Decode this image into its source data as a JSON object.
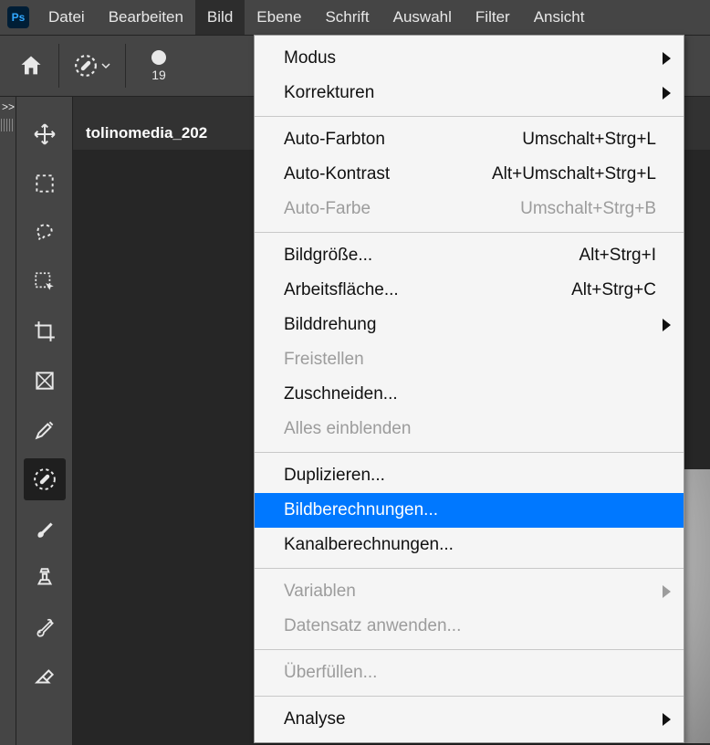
{
  "app": {
    "logo_text": "Ps"
  },
  "menubar": {
    "items": [
      "Datei",
      "Bearbeiten",
      "Bild",
      "Ebene",
      "Schrift",
      "Auswahl",
      "Filter",
      "Ansicht"
    ],
    "active_index": 2
  },
  "optionsbar": {
    "brush_size": "19"
  },
  "ruler": {
    "expand": ">>"
  },
  "tabs": {
    "active": "tolinomedia_202"
  },
  "dropdown": {
    "groups": [
      [
        {
          "label": "Modus",
          "submenu": true
        },
        {
          "label": "Korrekturen",
          "submenu": true
        }
      ],
      [
        {
          "label": "Auto-Farbton",
          "shortcut": "Umschalt+Strg+L"
        },
        {
          "label": "Auto-Kontrast",
          "shortcut": "Alt+Umschalt+Strg+L"
        },
        {
          "label": "Auto-Farbe",
          "shortcut": "Umschalt+Strg+B",
          "disabled": true
        }
      ],
      [
        {
          "label": "Bildgröße...",
          "shortcut": "Alt+Strg+I"
        },
        {
          "label": "Arbeitsfläche...",
          "shortcut": "Alt+Strg+C"
        },
        {
          "label": "Bilddrehung",
          "submenu": true
        },
        {
          "label": "Freistellen",
          "disabled": true
        },
        {
          "label": "Zuschneiden..."
        },
        {
          "label": "Alles einblenden",
          "disabled": true
        }
      ],
      [
        {
          "label": "Duplizieren..."
        },
        {
          "label": "Bildberechnungen...",
          "hover": true
        },
        {
          "label": "Kanalberechnungen..."
        }
      ],
      [
        {
          "label": "Variablen",
          "submenu": true,
          "disabled": true
        },
        {
          "label": "Datensatz anwenden...",
          "disabled": true
        }
      ],
      [
        {
          "label": "Überfüllen...",
          "disabled": true
        }
      ],
      [
        {
          "label": "Analyse",
          "submenu": true
        }
      ]
    ]
  },
  "tools": [
    {
      "name": "move-tool"
    },
    {
      "name": "marquee-tool"
    },
    {
      "name": "lasso-tool"
    },
    {
      "name": "object-select-tool"
    },
    {
      "name": "crop-tool"
    },
    {
      "name": "frame-tool"
    },
    {
      "name": "eyedropper-tool"
    },
    {
      "name": "healing-brush-tool",
      "selected": true
    },
    {
      "name": "brush-tool"
    },
    {
      "name": "clone-stamp-tool"
    },
    {
      "name": "history-brush-tool"
    },
    {
      "name": "eraser-tool"
    }
  ]
}
